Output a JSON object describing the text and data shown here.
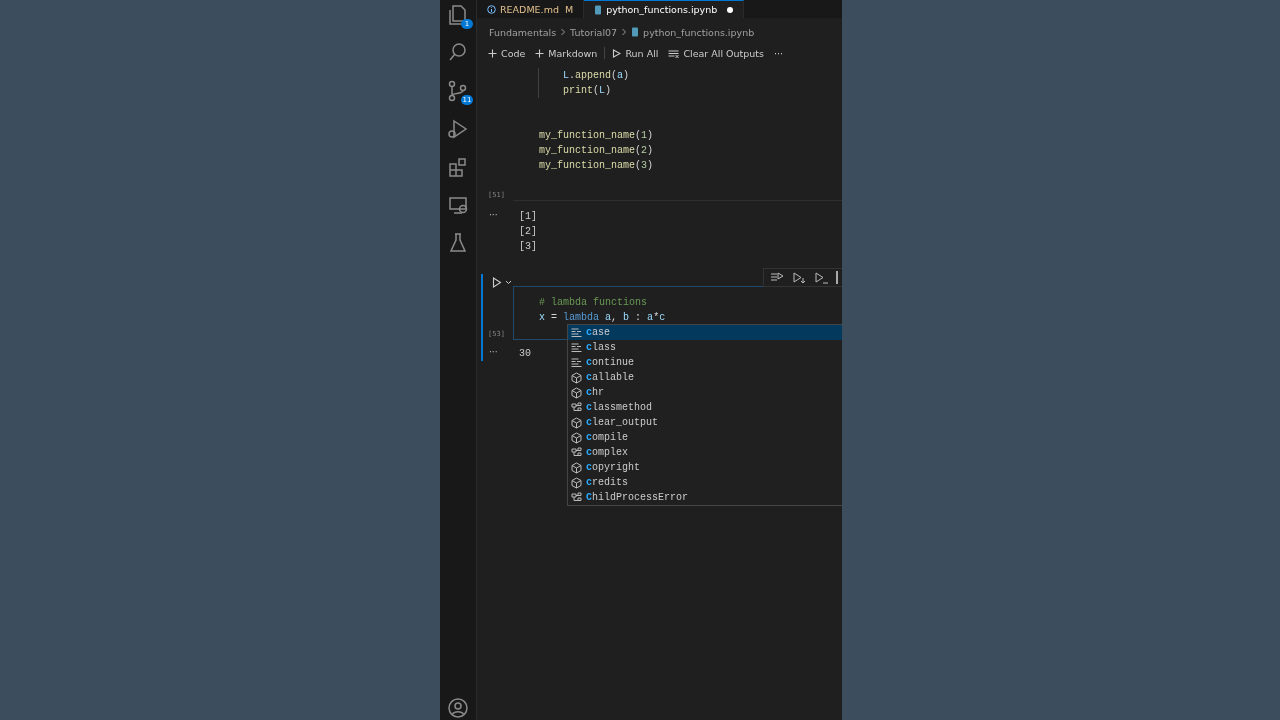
{
  "activity_bar": {
    "items": [
      {
        "kind": "files",
        "badge": "1"
      },
      {
        "kind": "search"
      },
      {
        "kind": "source-control",
        "badge": "11"
      },
      {
        "kind": "run"
      },
      {
        "kind": "extensions"
      },
      {
        "kind": "remote"
      },
      {
        "kind": "testing"
      }
    ],
    "bottom": [
      {
        "kind": "account"
      }
    ]
  },
  "tabs": [
    {
      "label": "README.md",
      "kind": "info",
      "status": "M",
      "selected": false,
      "modified": false
    },
    {
      "label": "python_functions.ipynb",
      "kind": "notebook",
      "selected": true,
      "modified": true
    }
  ],
  "breadcrumb": [
    "Fundamentals",
    "Tutorial07",
    "python_functions.ipynb"
  ],
  "toolbar": [
    {
      "kind": "plus",
      "label": "Code"
    },
    {
      "kind": "plus",
      "label": "Markdown"
    },
    {
      "kind": "run",
      "label": "Run All"
    },
    {
      "kind": "clear",
      "label": "Clear All Outputs"
    },
    {
      "kind": "more",
      "label": "···"
    }
  ],
  "cells": [
    {
      "focused": false,
      "execution_count": "[51]",
      "lines": [
        {
          "indented": true,
          "tokens": [
            {
              "text": "L",
              "kind": "var"
            },
            {
              "text": ".",
              "kind": "plain"
            },
            {
              "text": "append",
              "kind": "func"
            },
            {
              "text": "(",
              "kind": "plain"
            },
            {
              "text": "a",
              "kind": "var"
            },
            {
              "text": ")",
              "kind": "plain"
            }
          ]
        },
        {
          "indented": true,
          "tokens": [
            {
              "text": "print",
              "kind": "func"
            },
            {
              "text": "(",
              "kind": "plain"
            },
            {
              "text": "L",
              "kind": "var"
            },
            {
              "text": ")",
              "kind": "plain"
            }
          ]
        },
        {
          "indented": false
        },
        {
          "indented": false
        },
        {
          "indented": false,
          "tokens": [
            {
              "text": "my_function_name",
              "kind": "func"
            },
            {
              "text": "(",
              "kind": "plain"
            },
            {
              "text": "1",
              "kind": "num"
            },
            {
              "text": ")",
              "kind": "plain"
            }
          ]
        },
        {
          "indented": false,
          "tokens": [
            {
              "text": "my_function_name",
              "kind": "func"
            },
            {
              "text": "(",
              "kind": "plain"
            },
            {
              "text": "2",
              "kind": "num"
            },
            {
              "text": ")",
              "kind": "plain"
            }
          ]
        },
        {
          "indented": false,
          "tokens": [
            {
              "text": "my_function_name",
              "kind": "func"
            },
            {
              "text": "(",
              "kind": "plain"
            },
            {
              "text": "3",
              "kind": "num"
            },
            {
              "text": ")",
              "kind": "plain"
            }
          ]
        }
      ],
      "output_menu": "···",
      "output": [
        "[1]",
        "[2]",
        "[3]"
      ]
    },
    {
      "focused": true,
      "execution_count": "[53]",
      "lines": [
        {
          "indented": false,
          "tokens": [
            {
              "text": "# lambda functions",
              "kind": "comment"
            }
          ]
        },
        {
          "indented": false,
          "tokens": [
            {
              "text": "x",
              "kind": "var"
            },
            {
              "text": " = ",
              "kind": "plain"
            },
            {
              "text": "lambda",
              "kind": "keyword"
            },
            {
              "text": " a",
              "kind": "var"
            },
            {
              "text": ", ",
              "kind": "plain"
            },
            {
              "text": "b",
              "kind": "var"
            },
            {
              "text": " : ",
              "kind": "plain"
            },
            {
              "text": "a",
              "kind": "var"
            },
            {
              "text": "*",
              "kind": "plain"
            },
            {
              "text": "c",
              "kind": "var"
            }
          ]
        }
      ],
      "output_menu": "···",
      "output": [
        "30"
      ]
    }
  ],
  "cell_toolbar": [
    {
      "kind": "run-above"
    },
    {
      "kind": "run-cell-below"
    },
    {
      "kind": "run-below"
    }
  ],
  "suggestions": [
    {
      "label": "case",
      "kind": "keyword",
      "selected": true
    },
    {
      "label": "class",
      "kind": "keyword",
      "selected": false
    },
    {
      "label": "continue",
      "kind": "keyword",
      "selected": false
    },
    {
      "label": "callable",
      "kind": "function",
      "selected": false
    },
    {
      "label": "chr",
      "kind": "function",
      "selected": false
    },
    {
      "label": "classmethod",
      "kind": "class",
      "selected": false
    },
    {
      "label": "clear_output",
      "kind": "function",
      "selected": false
    },
    {
      "label": "compile",
      "kind": "function",
      "selected": false
    },
    {
      "label": "complex",
      "kind": "class",
      "selected": false
    },
    {
      "label": "copyright",
      "kind": "function",
      "selected": false
    },
    {
      "label": "credits",
      "kind": "function",
      "selected": false
    },
    {
      "label": "ChildProcessError",
      "kind": "class",
      "selected": false
    }
  ]
}
